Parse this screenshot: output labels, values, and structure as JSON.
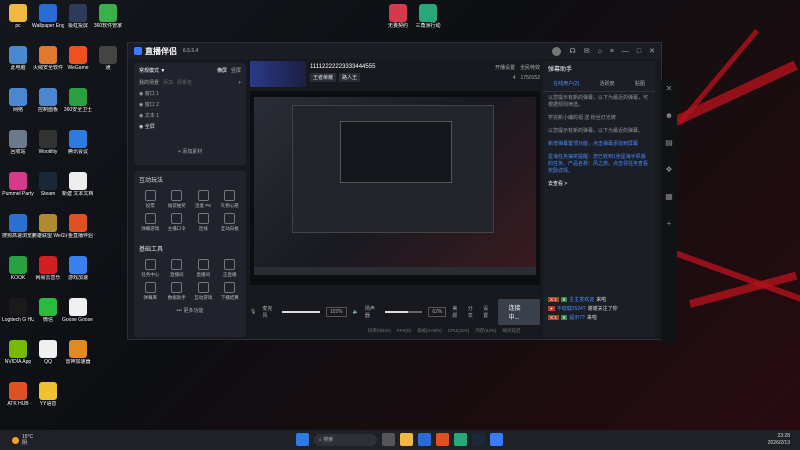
{
  "desktop": {
    "top_icons": [
      {
        "label": "无畏契约",
        "color": "#d63a4a"
      },
      {
        "label": "三角洲行动",
        "color": "#28a87a"
      }
    ],
    "icons": [
      {
        "label": "pc",
        "color": "#f0b840"
      },
      {
        "label": "Wallpaper Engine: ...",
        "color": "#2a6cd6"
      },
      {
        "label": "极虹投屏",
        "color": "#2d3a5a"
      },
      {
        "label": "360软件管家",
        "color": "#3ab04a"
      },
      {
        "label": "此电脑",
        "color": "#4a88d0"
      },
      {
        "label": "火绒安全软件",
        "color": "#e07830"
      },
      {
        "label": "WeGame",
        "color": "#f05020"
      },
      {
        "label": "通",
        "color": "#444"
      },
      {
        "label": "网络",
        "color": "#4a88d0"
      },
      {
        "label": "控制面板",
        "color": "#4a88d0"
      },
      {
        "label": "360安全卫士",
        "color": "#2aa040"
      },
      {
        "label": "回收站",
        "color": "#6a7a8a"
      },
      {
        "label": "Wootility",
        "color": "#333"
      },
      {
        "label": "腾讯会议",
        "color": "#2d7ae0"
      },
      {
        "label": "Pummel Party",
        "color": "#d63a8a"
      },
      {
        "label": "Steam",
        "color": "#1b2838"
      },
      {
        "label": "新建 文本文档 (2)",
        "color": "#eee"
      },
      {
        "label": "搜狗高速浏览器",
        "color": "#2a70d0"
      },
      {
        "label": "英雄联盟 WeGame版",
        "color": "#b08a30"
      },
      {
        "label": "斗鱼直播伴侣",
        "color": "#e05020"
      },
      {
        "label": "KOOK",
        "color": "#2aa040"
      },
      {
        "label": "网易云音乐",
        "color": "#d02020"
      },
      {
        "label": "游戏加速",
        "color": "#3a80f0"
      },
      {
        "label": "Logitech G HUB",
        "color": "#1a1a1a"
      },
      {
        "label": "微信",
        "color": "#2aba40"
      },
      {
        "label": "Goose Goose Duck",
        "color": "#f0f0f0"
      },
      {
        "label": "NVIDIA App",
        "color": "#76b900"
      },
      {
        "label": "QQ",
        "color": "#f0f0f0"
      },
      {
        "label": "雷神加速器",
        "color": "#e08a20"
      },
      {
        "label": "ATK HUB",
        "color": "#e05020"
      },
      {
        "label": "YY语音",
        "color": "#f0c030"
      }
    ]
  },
  "window": {
    "app_name": "直播伴侣",
    "version": "6.5.5.4",
    "left_panel": {
      "mode_title": "常规模式 ▼",
      "tab_landscape": "横屏",
      "tab_portrait": "竖屏",
      "scene_title": "我的场景",
      "scene_tabs": [
        "添加",
        "场景名"
      ],
      "sources": [
        "窗口 1",
        "窗口 2",
        "文本 1",
        "全屏"
      ],
      "add_material": "+ 添加素材",
      "interaction_title": "互动玩法",
      "interaction_tools": [
        "投票",
        "福袋抽奖",
        "连麦 PK",
        "礼物心愿",
        "弹幕游戏",
        "主播口令",
        "连线",
        "互动白板"
      ],
      "basic_title": "基础工具",
      "basic_tools": [
        "任务中心",
        "直播间",
        "直播间",
        "正直播"
      ],
      "basic_tools2": [
        "弹幕库",
        "数据助手",
        "互动游戏",
        "下播结算"
      ],
      "more": "••• 更多功能"
    },
    "center": {
      "room_id": "11112222223333444555",
      "tag1": "王者荣耀",
      "tag2": "路人王",
      "actions": [
        "开播设置",
        "全民特效"
      ],
      "viewers": "4",
      "likes": "1750152",
      "mic_label": "麦克风",
      "mic_percent": "102%",
      "speaker_label": "扬声器",
      "speaker_percent": "62%",
      "btn_effect": "美颜",
      "btn_share": "分享",
      "btn_settings": "设置",
      "btn_live": "连接中...",
      "status": [
        "码率(0kb/s)",
        "FPS(0)",
        "丢帧(0.00%)",
        "CPU(10%)",
        "内存(53%)",
        "帧间延迟"
      ]
    },
    "right_panel": {
      "title": "弹幕助手",
      "tabs": [
        "在线用户(2)",
        "活跃度",
        "贴图"
      ],
      "intro": "以您提示有新的弹幕，以下为最近的弹幕，可根据规则筛选。",
      "notice1": "学完新小编的视 送 粉丝灯光牌",
      "notice2": "以您提示有新的弹幕，以下为最近的弹幕。",
      "highlight": "新增弹幕置顶功能，点击弹幕添加到屏幕",
      "link_text": "星海任务抽奖提醒：您已收到1张星海手机版的任务，产品名称：风之旅。点击领任务查看奖励详情。",
      "view_btn": "去查看 >",
      "chats": [
        {
          "badge": "X 1",
          "badge2": "8",
          "name": "主主发欢迎",
          "text": "来啦"
        },
        {
          "badge": "●",
          "badge2": "",
          "name": "不稳健2524?",
          "text": "谢谢关注了你"
        },
        {
          "badge": "X 1",
          "badge2": "8",
          "name": "提示7?",
          "text": "来啦"
        }
      ]
    }
  },
  "taskbar": {
    "temp": "15°C",
    "weather": "阴",
    "search": "搜索",
    "time": "23:28",
    "date": "2026/2/13"
  }
}
